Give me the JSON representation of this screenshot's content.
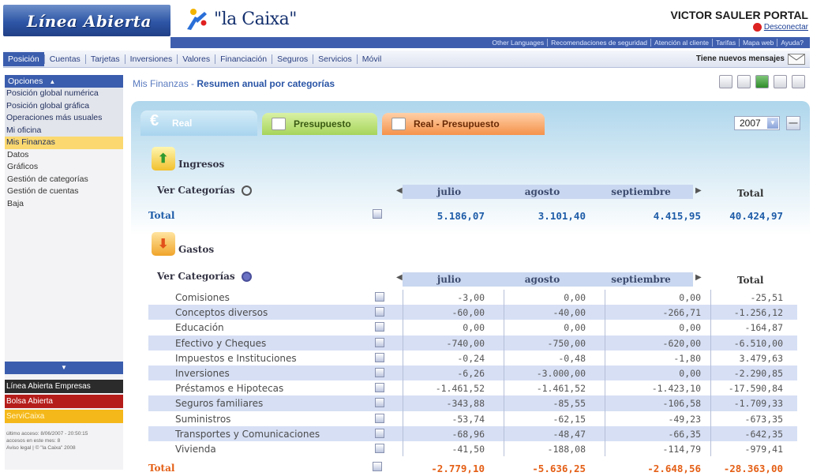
{
  "header": {
    "brand": "Línea Abierta",
    "bank_logo_text": "\"la Caixa\"",
    "user_name": "VICTOR SAULER PORTAL",
    "logout_label": "Desconectar",
    "top_links": [
      "Other Languages",
      "Recomendaciones de seguridad",
      "Atención al cliente",
      "Tarifas",
      "Mapa web",
      "Ayuda?"
    ],
    "nav": [
      "Posición",
      "Cuentas",
      "Tarjetas",
      "Inversiones",
      "Valores",
      "Financiación",
      "Seguros",
      "Servicios",
      "Móvil"
    ],
    "messages_label": "Tiene nuevos mensajes"
  },
  "sidebar": {
    "title": "Opciones",
    "items": [
      {
        "label": "Posición global numérica"
      },
      {
        "label": "Posición global gráfica"
      },
      {
        "label": "Operaciones más usuales"
      },
      {
        "label": "Mi oficina"
      },
      {
        "label": "Mis Finanzas"
      }
    ],
    "sub_items": [
      {
        "label": "Datos"
      },
      {
        "label": "Gráficos"
      },
      {
        "label": "Gestión de categorías"
      },
      {
        "label": "Gestión de cuentas"
      },
      {
        "label": "Baja"
      }
    ],
    "promos": [
      "Línea Abierta Empresas",
      "Bolsa Abierta",
      "ServiCaixa"
    ],
    "session_info": [
      "último acceso: 8/06/2007 - 20:50:15",
      "accesos en este mes: 8",
      "Aviso legal | © \"la Caixa\" 2008"
    ]
  },
  "page": {
    "title_prefix": "Mis Finanzas -",
    "title": "Resumen anual por categorías"
  },
  "tabs": [
    {
      "label": "Real"
    },
    {
      "label": "Presupuesto"
    },
    {
      "label": "Real - Presupuesto"
    }
  ],
  "year": "2007",
  "ingresos": {
    "label": "Ingresos",
    "ver_categorias": "Ver Categorías",
    "columns": [
      "julio",
      "agosto",
      "septiembre"
    ],
    "total_col": "Total",
    "total_label": "Total",
    "totals": [
      "5.186,07",
      "3.101,40",
      "4.415,95",
      "40.424,97"
    ]
  },
  "gastos": {
    "label": "Gastos",
    "ver_categorias": "Ver Categorías",
    "columns": [
      "julio",
      "agosto",
      "septiembre"
    ],
    "total_col": "Total",
    "rows": [
      {
        "name": "Comisiones",
        "julio": "-3,00",
        "agosto": "0,00",
        "septiembre": "0,00",
        "total": "-25,51"
      },
      {
        "name": "Conceptos diversos",
        "julio": "-60,00",
        "agosto": "-40,00",
        "septiembre": "-266,71",
        "total": "-1.256,12"
      },
      {
        "name": "Educación",
        "julio": "0,00",
        "agosto": "0,00",
        "septiembre": "0,00",
        "total": "-164,87"
      },
      {
        "name": "Efectivo y Cheques",
        "julio": "-740,00",
        "agosto": "-750,00",
        "septiembre": "-620,00",
        "total": "-6.510,00"
      },
      {
        "name": "Impuestos e Instituciones",
        "julio": "-0,24",
        "agosto": "-0,48",
        "septiembre": "-1,80",
        "total": "3.479,63"
      },
      {
        "name": "Inversiones",
        "julio": "-6,26",
        "agosto": "-3.000,00",
        "septiembre": "0,00",
        "total": "-2.290,85"
      },
      {
        "name": "Préstamos e Hipotecas",
        "julio": "-1.461,52",
        "agosto": "-1.461,52",
        "septiembre": "-1.423,10",
        "total": "-17.590,84"
      },
      {
        "name": "Seguros familiares",
        "julio": "-343,88",
        "agosto": "-85,55",
        "septiembre": "-106,58",
        "total": "-1.709,33"
      },
      {
        "name": "Suministros",
        "julio": "-53,74",
        "agosto": "-62,15",
        "septiembre": "-49,23",
        "total": "-673,35"
      },
      {
        "name": "Transportes y Comunicaciones",
        "julio": "-68,96",
        "agosto": "-48,47",
        "septiembre": "-66,35",
        "total": "-642,35"
      },
      {
        "name": "Vivienda",
        "julio": "-41,50",
        "agosto": "-188,08",
        "septiembre": "-114,79",
        "total": "-979,41"
      }
    ],
    "total_label": "Total",
    "totals": [
      "-2.779,10",
      "-5.636,25",
      "-2.648,56",
      "-28.363,00"
    ]
  }
}
